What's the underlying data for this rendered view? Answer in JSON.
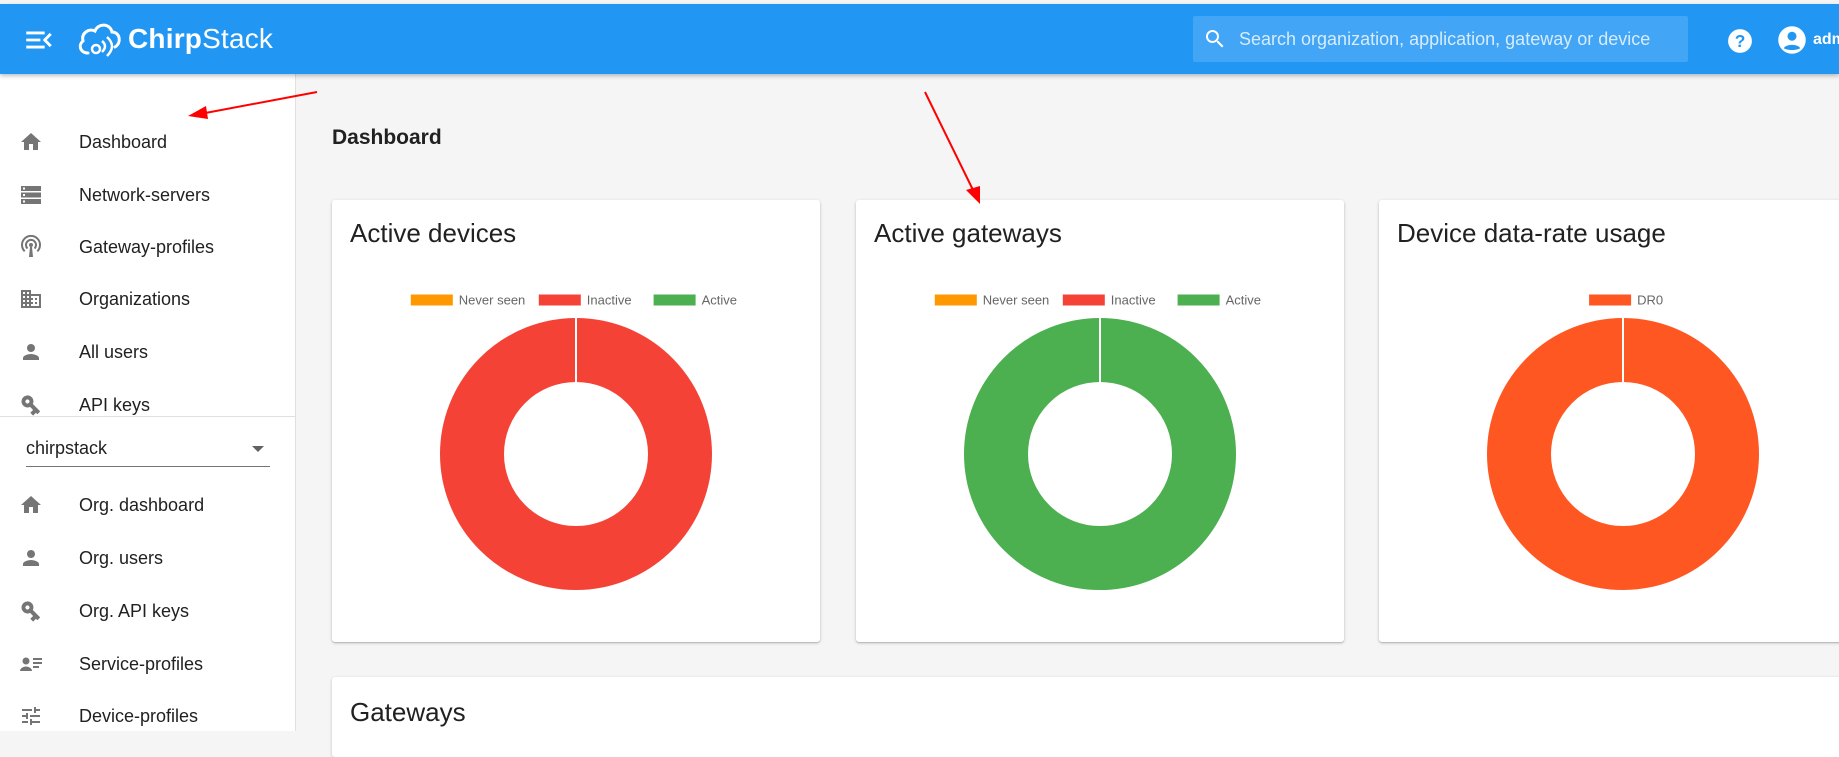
{
  "app": {
    "logo_text_bold": "Chirp",
    "logo_text_light": "Stack"
  },
  "header": {
    "search_placeholder": "Search organization, application, gateway or device",
    "user_label": "adm"
  },
  "sidebar": {
    "global_items": [
      {
        "label": "Dashboard",
        "icon": "home-icon"
      },
      {
        "label": "Network-servers",
        "icon": "server-icon"
      },
      {
        "label": "Gateway-profiles",
        "icon": "radio-tower-icon"
      },
      {
        "label": "Organizations",
        "icon": "domain-icon"
      },
      {
        "label": "All users",
        "icon": "person-icon"
      },
      {
        "label": "API keys",
        "icon": "key-icon"
      }
    ],
    "org_select_value": "chirpstack",
    "org_items": [
      {
        "label": "Org. dashboard",
        "icon": "home-icon"
      },
      {
        "label": "Org. users",
        "icon": "person-icon"
      },
      {
        "label": "Org. API keys",
        "icon": "key-icon"
      },
      {
        "label": "Service-profiles",
        "icon": "account-details-icon"
      },
      {
        "label": "Device-profiles",
        "icon": "tune-icon"
      }
    ]
  },
  "main": {
    "page_title": "Dashboard",
    "gateways_card_title": "Gateways"
  },
  "colors": {
    "primary": "#2196f3",
    "never_seen": "#ff9800",
    "inactive": "#f44336",
    "active": "#4caf50",
    "dr0": "#ff5722",
    "annotation_arrow": "#ff0000"
  },
  "chart_data": [
    {
      "type": "pie",
      "title": "Active devices",
      "categories": [
        "Never seen",
        "Inactive",
        "Active"
      ],
      "values": [
        0,
        1,
        0
      ],
      "colors": [
        "#ff9800",
        "#f44336",
        "#4caf50"
      ],
      "legend": "top"
    },
    {
      "type": "pie",
      "title": "Active gateways",
      "categories": [
        "Never seen",
        "Inactive",
        "Active"
      ],
      "values": [
        0,
        0,
        1
      ],
      "colors": [
        "#ff9800",
        "#f44336",
        "#4caf50"
      ],
      "legend": "top"
    },
    {
      "type": "pie",
      "title": "Device data-rate usage",
      "categories": [
        "DR0"
      ],
      "values": [
        1
      ],
      "colors": [
        "#ff5722"
      ],
      "legend": "top"
    }
  ]
}
